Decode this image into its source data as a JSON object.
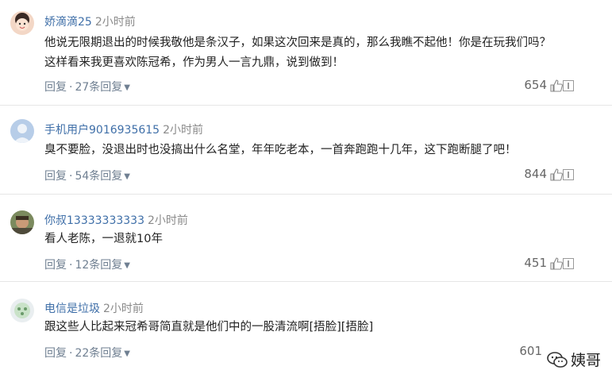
{
  "comments": [
    {
      "username": "娇滴滴25",
      "time": "2小时前",
      "lines": [
        "他说无限期退出的时候我敬他是条汉子，如果这次回来是真的，那么我瞧不起他！你是在玩我们吗？",
        "这样看来我更喜欢陈冠希，作为男人一言九鼎，说到做到！"
      ],
      "reply_label": "回复",
      "replies_label": "27条回复",
      "likes": "654"
    },
    {
      "username": "手机用户9016935615",
      "time": "2小时前",
      "lines": [
        "臭不要脸，没退出时也没搞出什么名堂，年年吃老本，一首奔跑跑十几年，这下跑断腿了吧！"
      ],
      "reply_label": "回复",
      "replies_label": "54条回复",
      "likes": "844"
    },
    {
      "username": "你叔13333333333",
      "time": "2小时前",
      "lines": [
        "看人老陈，一退就10年"
      ],
      "reply_label": "回复",
      "replies_label": "12条回复",
      "likes": "451"
    },
    {
      "username": "电信是垃圾",
      "time": "2小时前",
      "lines": [
        "跟这些人比起来冠希哥简直就是他们中的一股清流啊[捂脸][捂脸]"
      ],
      "reply_label": "回复",
      "replies_label": "22条回复",
      "likes": "601"
    }
  ],
  "watermark": {
    "text": "姨哥"
  },
  "icons": {
    "like": "thumbs-up-icon",
    "report": "report-icon",
    "expand": "chevron-down-icon",
    "watermark": "wechat-icon"
  },
  "colors": {
    "username": "#3f6fa8",
    "action": "#6f7f91",
    "text": "#222222",
    "divider": "#e6e6e6"
  }
}
